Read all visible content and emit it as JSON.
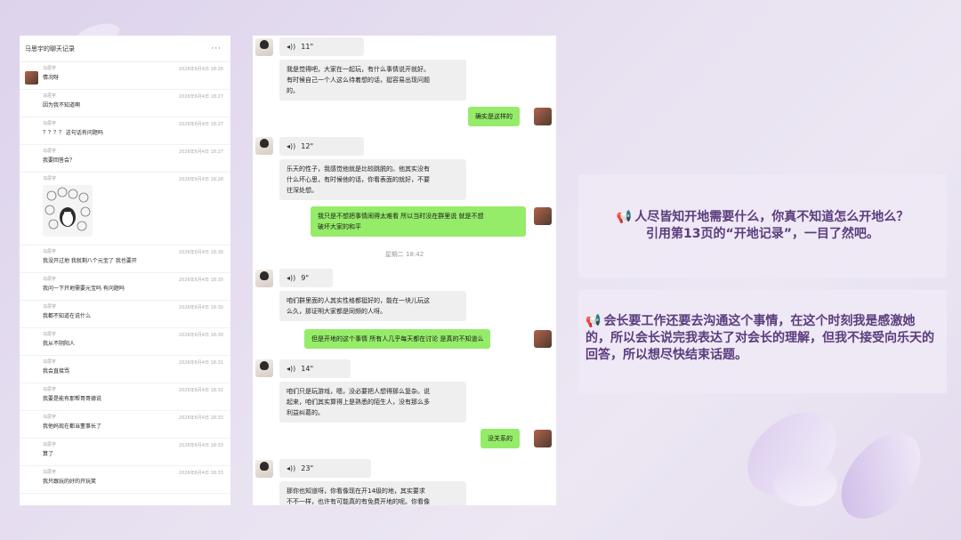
{
  "history": {
    "title": "马思宇的聊天记录",
    "more": "···",
    "rows": [
      {
        "name": "马思宇",
        "time": "2026年6月4日 18:26",
        "text": "情况呀",
        "avatar": true
      },
      {
        "name": "马思宇",
        "time": "2026年6月4日 18:27",
        "text": "因为我不知道啊"
      },
      {
        "name": "马思宇",
        "time": "2026年6月4日 18:27",
        "text": "？？？？ 这句话有问题吗"
      },
      {
        "name": "马思宇",
        "time": "2026年6月4日 18:27",
        "text": "我要回答会？"
      },
      {
        "name": "马思宇",
        "time": "2026年6月4日 18:28",
        "text": "",
        "sticker": true
      },
      {
        "name": "马思宇",
        "time": "2026年6月4日 18:30",
        "text": "我没开过地 我就剩八个元宝了 我也要开"
      },
      {
        "name": "马思宇",
        "time": "2026年6月4日 18:30",
        "text": "我问一下开地需要元宝吗 有问题吗"
      },
      {
        "name": "马思宇",
        "time": "2026年6月4日 18:30",
        "text": "我都不知道在说什么"
      },
      {
        "name": "马思宇",
        "time": "2026年6月4日 18:30",
        "text": "我从不阴阳人"
      },
      {
        "name": "马思宇",
        "time": "2026年6月4日 18:31",
        "text": "我会直接骂"
      },
      {
        "name": "马思宇",
        "time": "2026年6月4日 18:32",
        "text": "我要是能有那帮哥哥德说"
      },
      {
        "name": "马思宇",
        "time": "2026年6月4日 18:33",
        "text": "我他妈现在都当董事长了"
      },
      {
        "name": "马思宇",
        "time": "2026年6月4日 18:33",
        "text": "算了"
      },
      {
        "name": "马思宇",
        "time": "2026年6月4日 18:33",
        "text": "我只跟玩的好的开玩笑"
      }
    ]
  },
  "chat": {
    "voices": [
      "11\"",
      "12\"",
      "9\"",
      "14\"",
      "23\""
    ],
    "left_messages": [
      "我是觉得吧，大家在一起玩，有什么事情说开就好。\n有时候自己一个人这么待着想的话，挺容易出现问题\n的。",
      "乐天的性子，我感觉他就是比较跳脱的。他其实没有\n什么坏心思，有时候他的话，你看表面的就好，不要\n往深处想。",
      "咱们群里面的人其实性格都挺好的，能在一块儿玩这\n么久，那证明大家都是同频的人呀。",
      "咱们只是玩游戏，嗯，没必要把人想得那么复杂。说\n起来，咱们其实算得上是熟悉的陌生人，没有那么多\n利益纠葛的。",
      "那你也知道呀，你看像现在开14级的地，其实要求\n不不一样，也许有可能真的有免费开地的呢。你看像"
    ],
    "right_messages": [
      "确实是这样的",
      "我只是不想把事情闹得太难看 所以当时没在群里说 就是不想\n破坏大家的和平",
      "但是开地的这个事情 所有人几乎每天都在讨论 是真的不知道么",
      "没关系的"
    ],
    "timestamp": "星期二 18:42"
  },
  "notes": {
    "note1": "人尽皆知开地需要什么，你真不知道怎么开地么？\n引用第13页的“开地记录”，一目了然吧。",
    "note2": "会长要工作还要去沟通这个事情，在这个时刻我是感激她的，所以会长说完我表达了对会长的理解，但我不接受向乐天的回答，所以想尽快结束话题。",
    "icon": "megaphone-icon"
  },
  "colors": {
    "accent": "#5a3d7c",
    "bubble_right": "#95ec69",
    "bubble_left": "#efefef"
  }
}
